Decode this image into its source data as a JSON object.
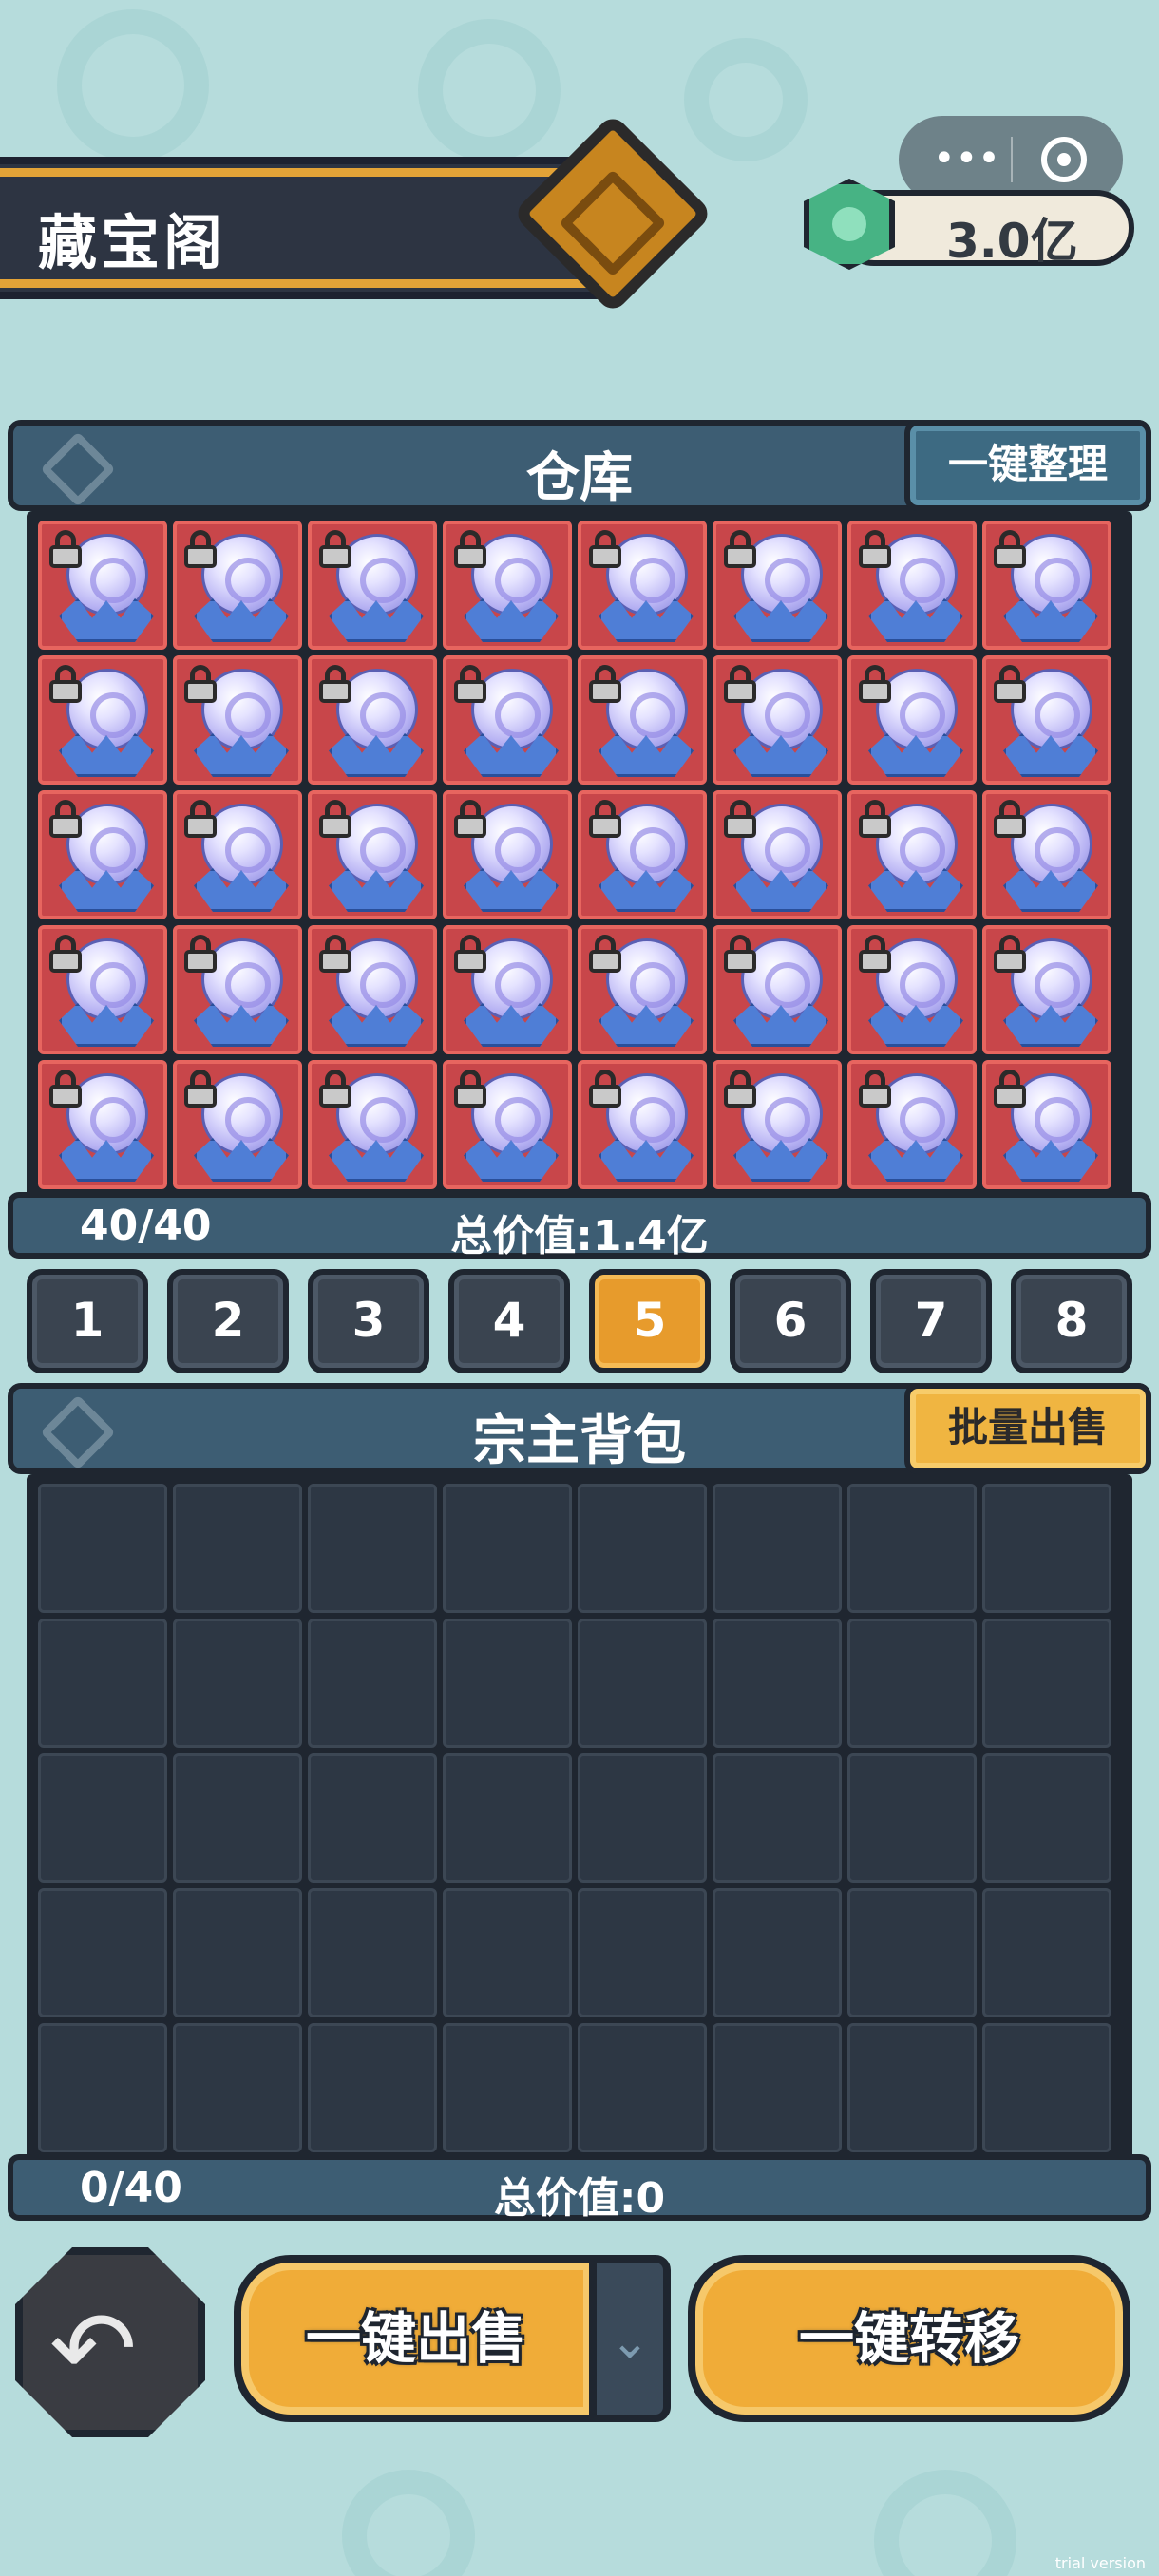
{
  "header": {
    "title": "藏宝阁",
    "currency": "3.0亿",
    "capsule": {
      "more_icon": "more-dots-icon",
      "close_icon": "target-icon"
    }
  },
  "warehouse": {
    "title": "仓库",
    "action_label": "一键整理",
    "count": "40/40",
    "total_value": "总价值:1.4亿",
    "slots_filled": 40,
    "slots_total": 40,
    "item": {
      "name": "lotus-orb-item",
      "locked": true
    }
  },
  "pages": {
    "labels": [
      "1",
      "2",
      "3",
      "4",
      "5",
      "6",
      "7",
      "8"
    ],
    "active": "5"
  },
  "backpack": {
    "title": "宗主背包",
    "action_label": "批量出售",
    "count": "0/40",
    "total_value": "总价值:0",
    "slots_filled": 0,
    "slots_total": 40
  },
  "footer": {
    "back_icon": "back-arrow-icon",
    "sell_all_label": "一键出售",
    "dropdown_icon": "chevron-down-icon",
    "transfer_all_label": "一键转移"
  },
  "watermark": "trial version",
  "colors": {
    "background": "#b6dcdc",
    "panel": "#3d5d73",
    "locked_cell": "#c8464a",
    "active_tab": "#e79b2c",
    "accent_button": "#f0ac38"
  }
}
